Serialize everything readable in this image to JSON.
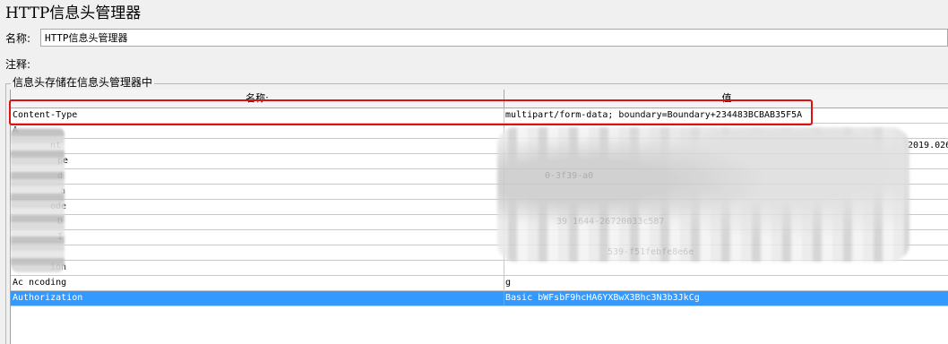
{
  "window": {
    "title": "HTTP信息头管理器"
  },
  "name_field": {
    "label": "名称:",
    "value": "HTTP信息头管理器"
  },
  "comment_field": {
    "label": "注释:",
    "value": ""
  },
  "headers_group": {
    "legend": "信息头存储在信息头管理器中"
  },
  "table": {
    "columns": [
      "名称:",
      "值"
    ],
    "rows": [
      {
        "name": "Content-Type",
        "value": "multipart/form-data; boundary=Boundary+234483BCBAB35F5A",
        "highlighted": true
      },
      {
        "name": "A",
        "value": ""
      },
      {
        "name": "nt",
        "value": "2019.026;"
      },
      {
        "name": "pe",
        "value": ""
      },
      {
        "name": "d",
        "value": "0-3f39-a0"
      },
      {
        "name": "a",
        "value": ""
      },
      {
        "name": "ode",
        "value": ""
      },
      {
        "name": "D",
        "value": "39 1644-26720033c587"
      },
      {
        "name": "I",
        "value": ""
      },
      {
        "name": "",
        "value": "539-f51febfe8e6e"
      },
      {
        "name": "ion",
        "value": ""
      },
      {
        "name": "Ac  ncoding",
        "value": "g"
      },
      {
        "name": "Authorization",
        "value": "Basic bWFsbF9hcHA6YXBwX3Bhc3N3b3JkCg",
        "selected": true
      }
    ]
  },
  "colors": {
    "selection": "#3399ff",
    "highlight_box": "#e01010"
  }
}
